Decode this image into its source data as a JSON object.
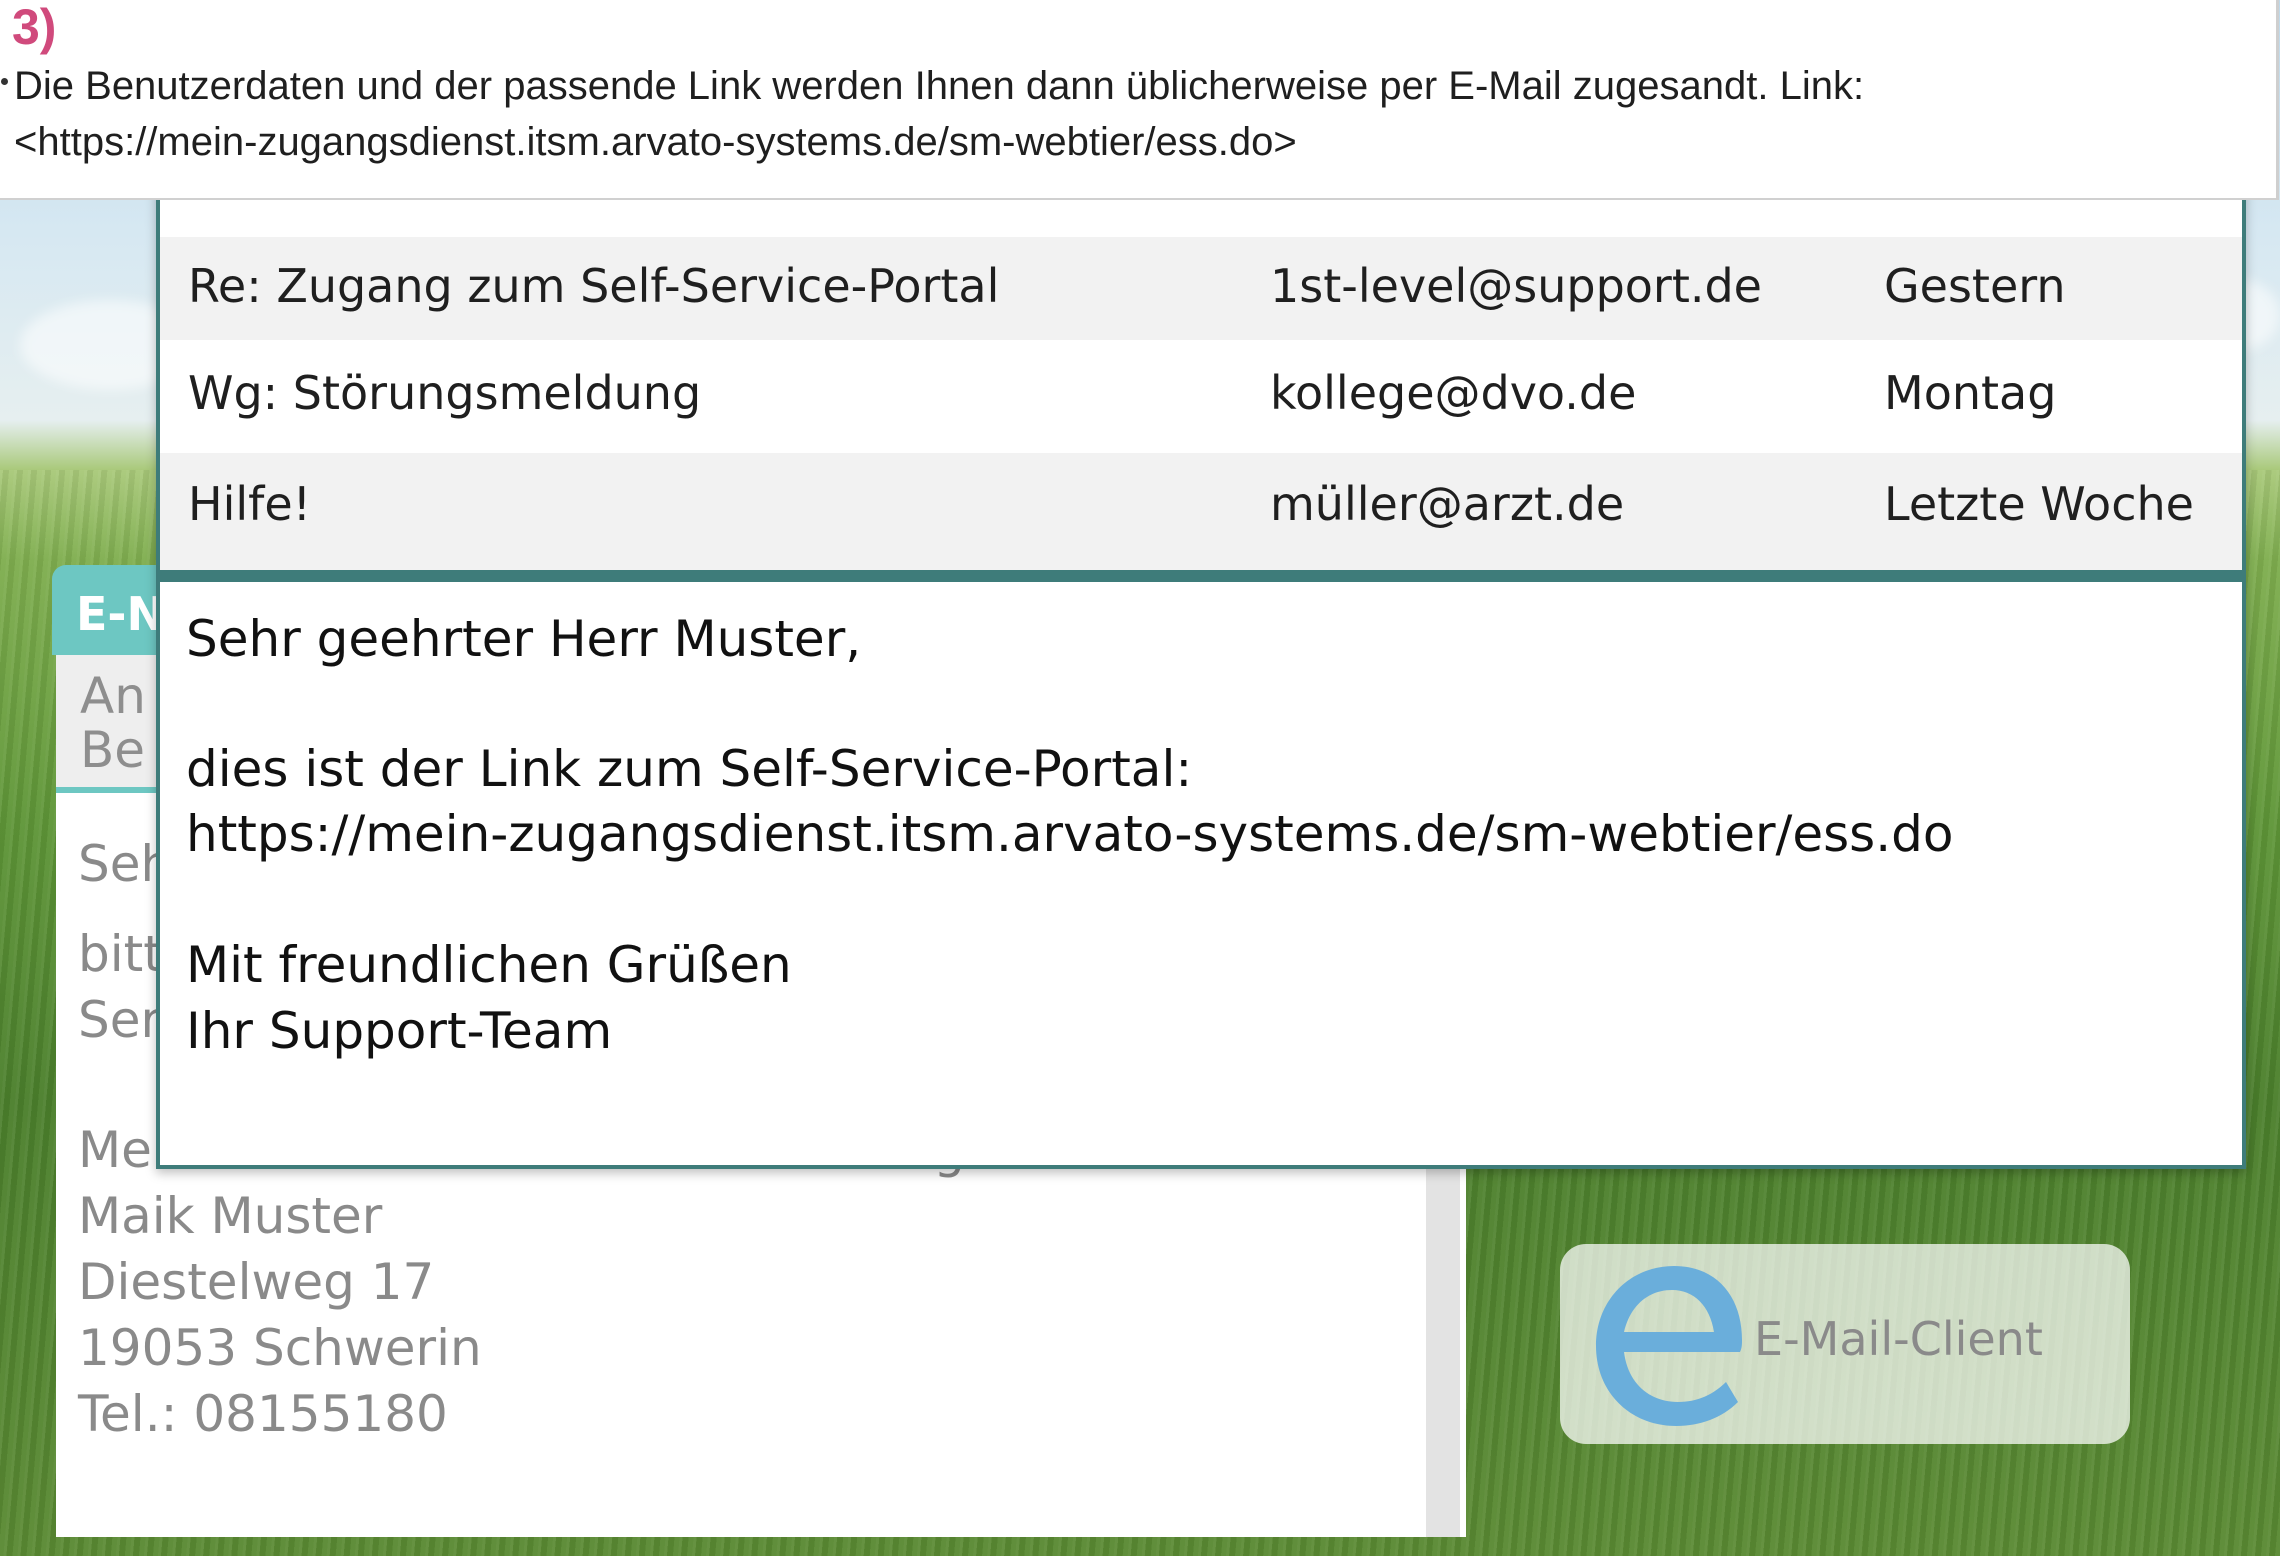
{
  "banner": {
    "step": "3)",
    "line1": "Die Benutzerdaten und der passende Link werden Ihnen dann üblicherweise per E-Mail zugesandt. Link:",
    "line2": "<https://mein-zugangsdienst.itsm.arvato-systems.de/sm-webtier/ess.do>"
  },
  "inbox": {
    "rows": [
      {
        "subject": "Re: Zugang zum Self-Service-Portal",
        "sender": "1st-level@support.de",
        "date": "Gestern"
      },
      {
        "subject": "Wg: Störungsmeldung",
        "sender": "kollege@dvo.de",
        "date": "Montag"
      },
      {
        "subject": "Hilfe!",
        "sender": "müller@arzt.de",
        "date": "Letzte Woche"
      }
    ],
    "message": {
      "greeting": "Sehr geehrter Herr Muster,",
      "line1": "dies ist der Link zum Self-Service-Portal:",
      "link": "https://mein-zugangsdienst.itsm.arvato-systems.de/sm-webtier/ess.do",
      "closing1": "Mit freundlichen Grüßen",
      "closing2": "Ihr Support-Team"
    }
  },
  "compose": {
    "title_visible": "E-N",
    "head_line1": "An",
    "head_line2": "Be",
    "body_partial1": "Seh",
    "body_partial2": "bitt",
    "body_partial3": "Ser",
    "contact_intro": "Meine Kontaktdaten lauten wie folgt:",
    "name": "Maik Muster",
    "street": "Diestelweg 17",
    "city": "19053 Schwerin",
    "phone": "Tel.: 08155180"
  },
  "client": {
    "label": "E-Mail-Client",
    "icon": "email-client-icon",
    "icon_color": "#6aaedb"
  },
  "colors": {
    "accent_teal": "#3e7c7a",
    "compose_teal": "#6dc7c2",
    "step_pink": "#d04a7c"
  }
}
